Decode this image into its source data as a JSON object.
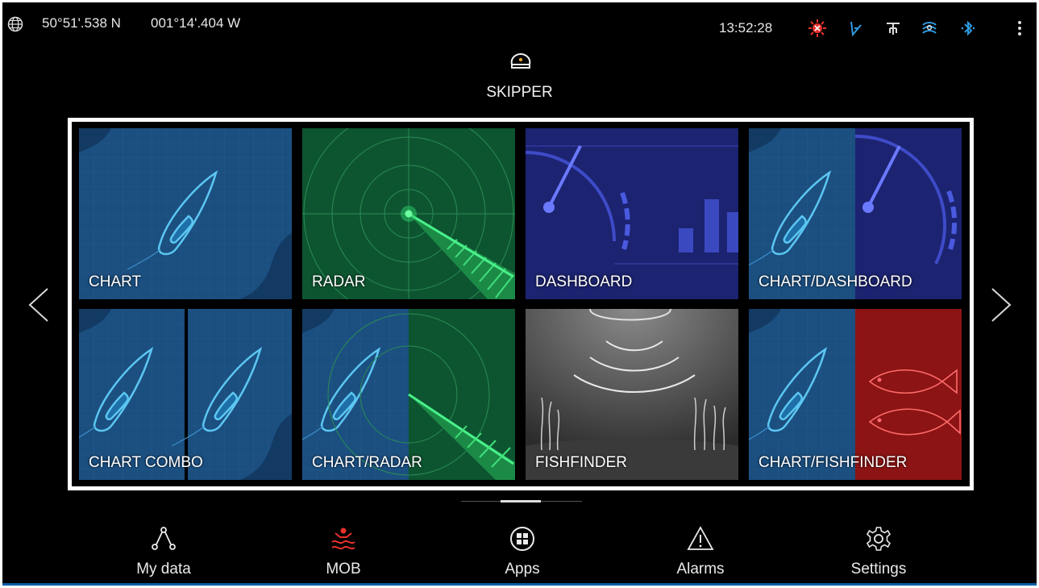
{
  "status_bar": {
    "latitude": "50°51'.538 N",
    "longitude": "001°14'.404 W",
    "time": "13:52:28",
    "icons": [
      "globe-icon",
      "gps-warning-icon",
      "autopilot-icon",
      "ais-icon",
      "sonar-icon",
      "bluetooth-icon",
      "more-options-icon"
    ],
    "warning_color": "#e8322b",
    "accent_color": "#2f9ae0"
  },
  "profile": {
    "name": "SKIPPER",
    "icon": "captain-hat-icon"
  },
  "apps": [
    {
      "label": "CHART"
    },
    {
      "label": "RADAR"
    },
    {
      "label": "DASHBOARD"
    },
    {
      "label": "CHART/DASHBOARD"
    },
    {
      "label": "CHART COMBO"
    },
    {
      "label": "CHART/RADAR"
    },
    {
      "label": "FISHFINDER"
    },
    {
      "label": "CHART/FISHFINDER"
    }
  ],
  "navigation": {
    "prev_icon": "chevron-left-icon",
    "next_icon": "chevron-right-icon"
  },
  "bottom_bar": {
    "my_data": "My data",
    "mob": "MOB",
    "apps": "Apps",
    "alarms": "Alarms",
    "settings": "Settings",
    "mob_color": "#e8322b"
  }
}
